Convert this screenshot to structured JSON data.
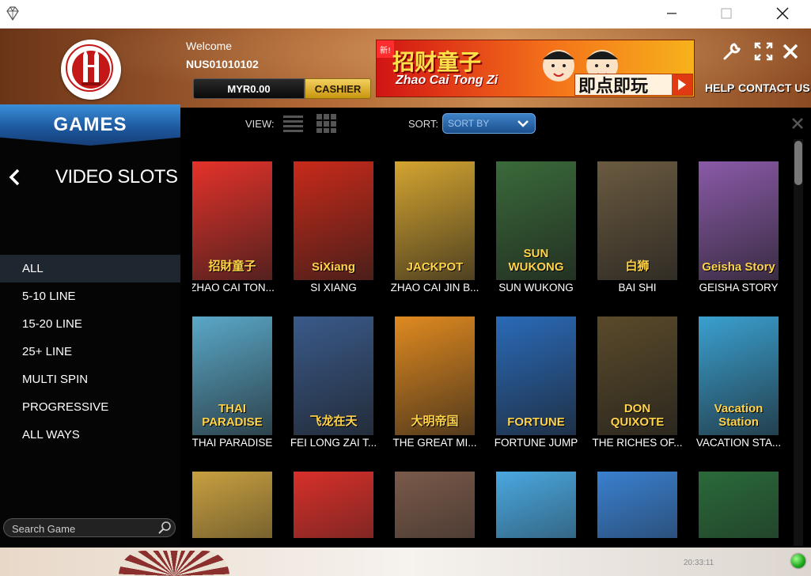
{
  "window": {
    "title": ""
  },
  "header": {
    "welcome": "Welcome",
    "username": "NUS01010102",
    "balance": "MYR0.00",
    "cashier_label": "CASHIER",
    "help_label": "HELP",
    "contact_label": "CONTACT US",
    "banner": {
      "new_badge": "新!",
      "title": "招财童子",
      "subtitle": "Zhao Cai Tong Zi",
      "cta": "即点即玩"
    }
  },
  "sidebar": {
    "tab_label": "GAMES",
    "section_title": "VIDEO SLOTS",
    "filters": [
      "ALL",
      "5-10 LINE",
      "15-20 LINE",
      "25+ LINE",
      "MULTI SPIN",
      "PROGRESSIVE",
      "ALL WAYS"
    ],
    "active_filter": "ALL",
    "search_placeholder": "Search Game"
  },
  "toolbar": {
    "view_label": "VIEW:",
    "sort_label": "SORT:",
    "sort_value": "SORT BY"
  },
  "games": [
    {
      "name": "ZHAO CAI TON...",
      "art_label": "招財童子",
      "color": "#e4322a"
    },
    {
      "name": "SI XIANG",
      "art_label": "SiXiang",
      "color": "#c82a1a"
    },
    {
      "name": "ZHAO CAI JIN B...",
      "art_label": "JACKPOT",
      "color": "#d4a430"
    },
    {
      "name": "SUN WUKONG",
      "art_label": "SUN WUKONG",
      "color": "#3a6a3a"
    },
    {
      "name": "BAI SHI",
      "art_label": "白狮",
      "color": "#6a5a40"
    },
    {
      "name": "GEISHA STORY",
      "art_label": "Geisha Story",
      "color": "#8a5aa8"
    },
    {
      "name": "THAI PARADISE",
      "art_label": "THAI PARADISE",
      "color": "#5aa8c8"
    },
    {
      "name": "FEI LONG ZAI T...",
      "art_label": "飞龙在天",
      "color": "#3a5a8a"
    },
    {
      "name": "THE GREAT MI...",
      "art_label": "大明帝国",
      "color": "#e08a20"
    },
    {
      "name": "FORTUNE JUMP",
      "art_label": "FORTUNE",
      "color": "#2a6ab8"
    },
    {
      "name": "THE RICHES OF...",
      "art_label": "DON QUIXOTE",
      "color": "#5a4a2a"
    },
    {
      "name": "VACATION STA...",
      "art_label": "Vacation Station",
      "color": "#3aa0d0"
    },
    {
      "name": "",
      "art_label": "",
      "color": "#c8a040"
    },
    {
      "name": "",
      "art_label": "",
      "color": "#d8302a"
    },
    {
      "name": "",
      "art_label": "",
      "color": "#7a5a4a"
    },
    {
      "name": "",
      "art_label": "",
      "color": "#4aa8e0"
    },
    {
      "name": "",
      "art_label": "",
      "color": "#3a80d0"
    },
    {
      "name": "",
      "art_label": "",
      "color": "#2a6a3a"
    }
  ],
  "status": {
    "clock": "20:33:11"
  },
  "colors": {
    "accent": "#1e5aa0",
    "cashier": "#e0b030",
    "sidebar_bg": "#050505"
  }
}
